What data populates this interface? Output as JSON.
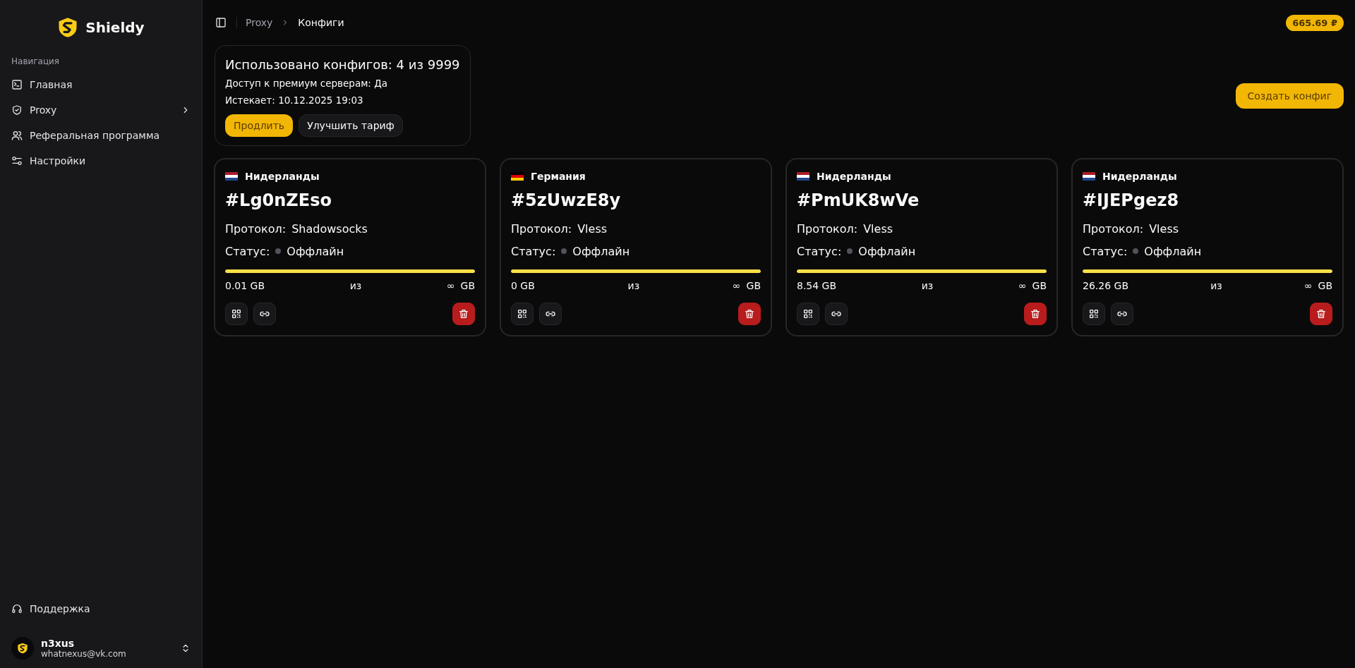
{
  "sidebar": {
    "brand": "Shieldy",
    "section_label": "Навигация",
    "items": [
      {
        "label": "Главная",
        "expandable": false
      },
      {
        "label": "Proxy",
        "expandable": true
      },
      {
        "label": "Реферальная программа",
        "expandable": false
      },
      {
        "label": "Настройки",
        "expandable": false
      }
    ],
    "support": "Поддержка",
    "user": {
      "name": "n3xus",
      "email": "whatnexus@vk.com"
    }
  },
  "breadcrumb": [
    "Proxy",
    "Конфиги"
  ],
  "balance": "665.69 ₽",
  "summary": {
    "title": "Использовано конфигов: 4 из 9999",
    "lines": [
      "Доступ к премиум серверам: Да",
      "Истекает: 10.12.2025 19:03"
    ],
    "buttons": [
      {
        "label": "Продлить",
        "kind": "primary"
      },
      {
        "label": "Улучшить тариф",
        "kind": "secondary"
      }
    ]
  },
  "create_button": "Создать конфиг",
  "configs": [
    {
      "country": "Нидерланды",
      "kind": "netherlands",
      "id": "#Lg0nZEso",
      "protocol_label": "Протокол:",
      "protocol": "Shadowsocks",
      "status_label": "Статус:",
      "status": "Оффлайн",
      "color": "#52525b",
      "level": 1,
      "used": "0.01 GB",
      "of": "из",
      "limit": "∞",
      "unit": "GB"
    },
    {
      "country": "Германия",
      "kind": "germany",
      "id": "#5zUwzE8y",
      "protocol_label": "Протокол:",
      "protocol": "Vless",
      "status_label": "Статус:",
      "status": "Оффлайн",
      "color": "#52525b",
      "level": 1,
      "used": "0 GB",
      "of": "из",
      "limit": "∞",
      "unit": "GB"
    },
    {
      "country": "Нидерланды",
      "kind": "netherlands",
      "id": "#PmUK8wVe",
      "protocol_label": "Протокол:",
      "protocol": "Vless",
      "status_label": "Статус:",
      "status": "Оффлайн",
      "color": "#52525b",
      "level": 1,
      "used": "8.54 GB",
      "of": "из",
      "limit": "∞",
      "unit": "GB"
    },
    {
      "country": "Нидерланды",
      "kind": "netherlands",
      "id": "#IJEPgez8",
      "protocol_label": "Протокол:",
      "protocol": "Vless",
      "status_label": "Статус:",
      "status": "Оффлайн",
      "color": "#52525b",
      "level": 1,
      "used": "26.26 GB",
      "of": "из",
      "limit": "∞",
      "unit": "GB"
    }
  ]
}
